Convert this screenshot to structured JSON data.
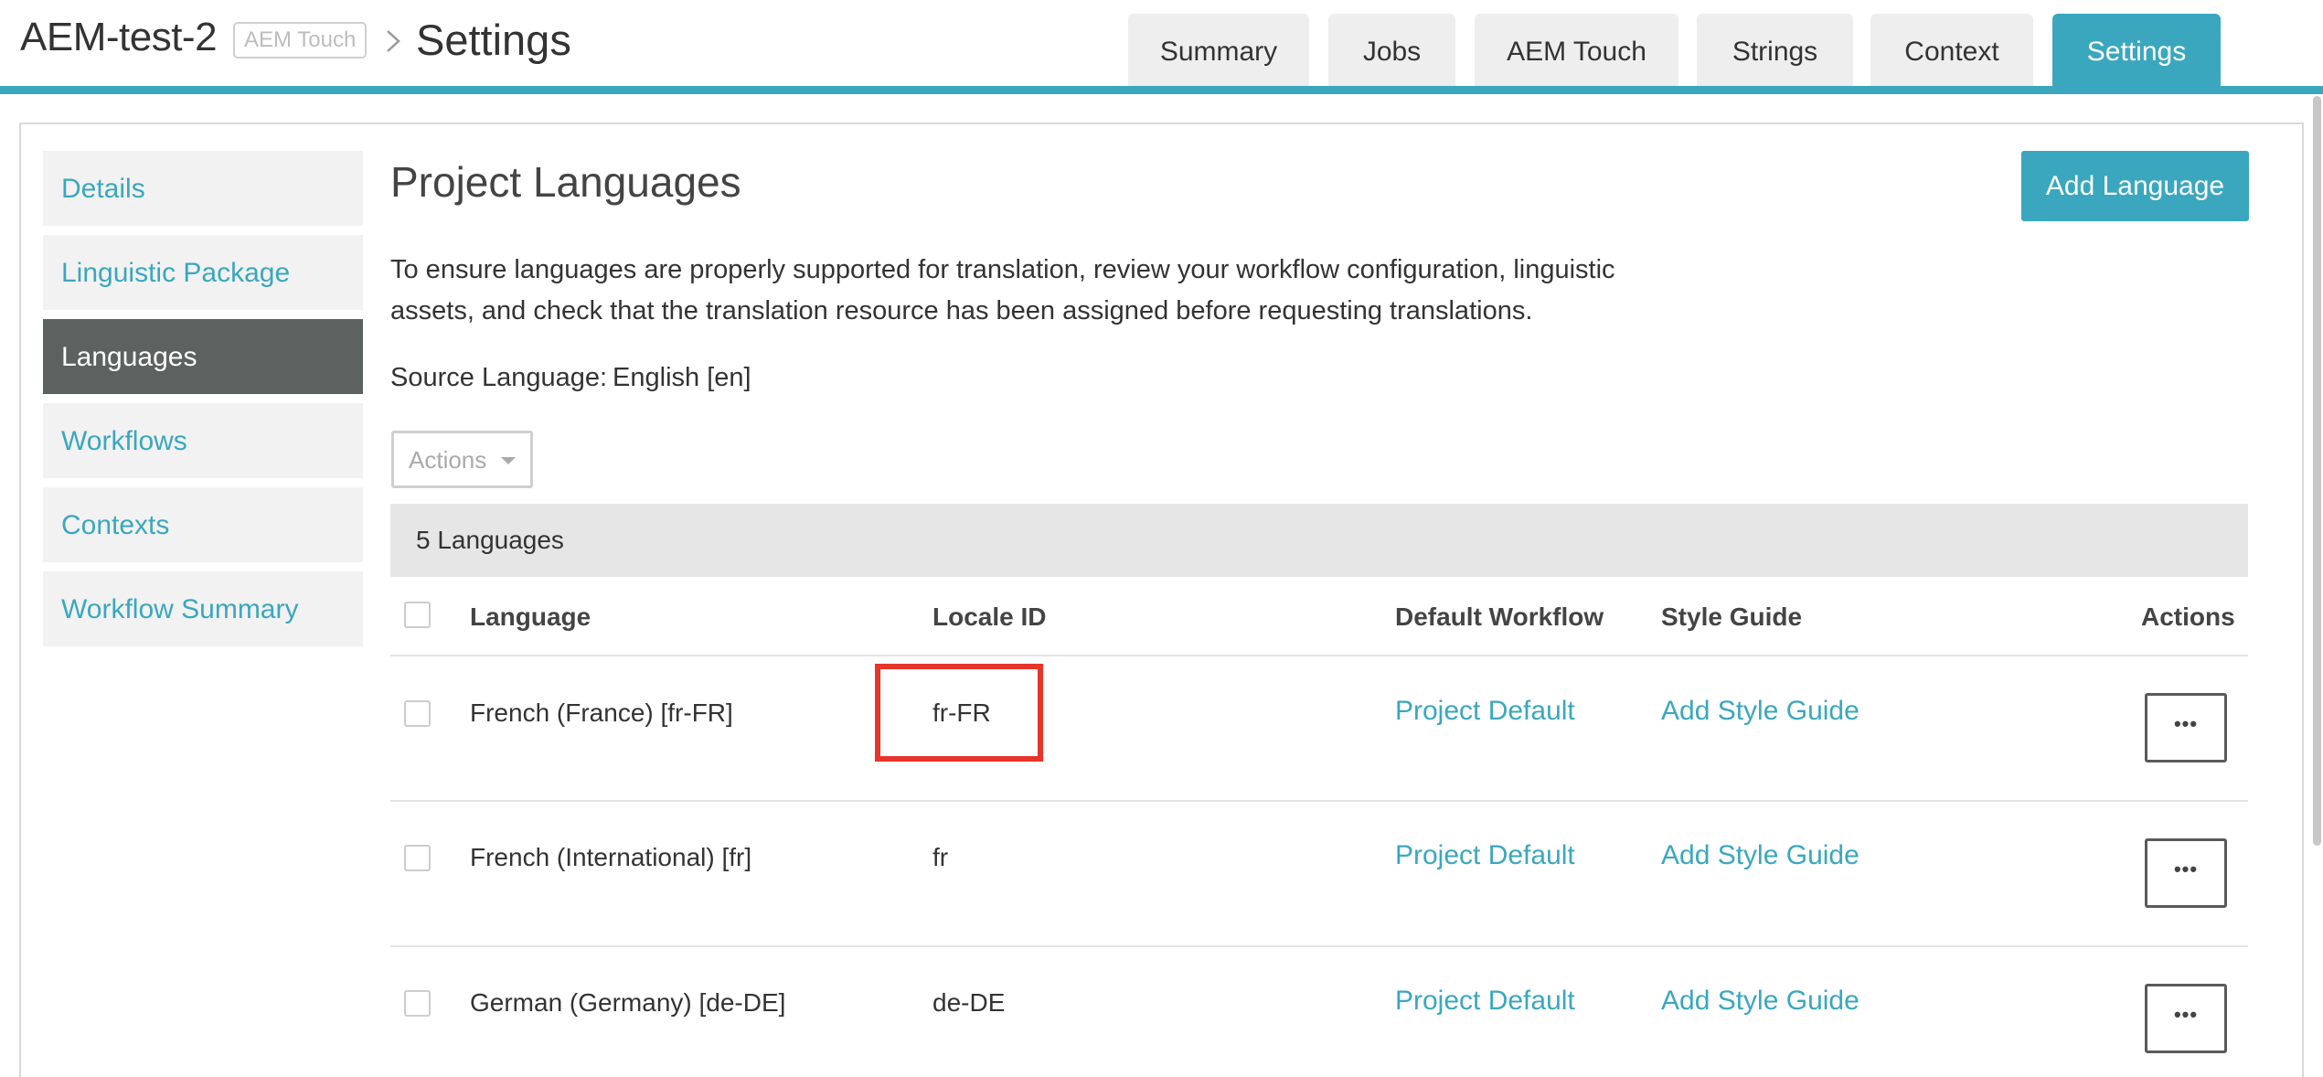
{
  "header": {
    "project_name": "AEM-test-2",
    "project_badge": "AEM Touch",
    "page_title": "Settings",
    "tabs": [
      {
        "label": "Summary",
        "active": false
      },
      {
        "label": "Jobs",
        "active": false
      },
      {
        "label": "AEM Touch",
        "active": false
      },
      {
        "label": "Strings",
        "active": false
      },
      {
        "label": "Context",
        "active": false
      },
      {
        "label": "Settings",
        "active": true
      }
    ]
  },
  "sidebar": {
    "items": [
      {
        "label": "Details",
        "active": false
      },
      {
        "label": "Linguistic Package",
        "active": false
      },
      {
        "label": "Languages",
        "active": true
      },
      {
        "label": "Workflows",
        "active": false
      },
      {
        "label": "Contexts",
        "active": false
      },
      {
        "label": "Workflow Summary",
        "active": false
      }
    ]
  },
  "main": {
    "title": "Project Languages",
    "add_language_label": "Add Language",
    "description_line1": "To ensure languages are properly supported for translation, review your workflow configuration, linguistic",
    "description_line2": "assets, and check that the translation resource has been assigned before requesting translations.",
    "source_language_label": "Source Language:",
    "source_language_value": "English [en]",
    "actions_dropdown_label": "Actions",
    "count_label": "5 Languages",
    "columns": {
      "language": "Language",
      "locale_id": "Locale ID",
      "default_workflow": "Default Workflow",
      "style_guide": "Style Guide",
      "actions": "Actions"
    },
    "rows": [
      {
        "language": "French (France) [fr-FR]",
        "locale_id": "fr-FR",
        "workflow": "Project Default",
        "style_guide": "Add Style Guide",
        "more": "•••"
      },
      {
        "language": "French (International) [fr]",
        "locale_id": "fr",
        "workflow": "Project Default",
        "style_guide": "Add Style Guide",
        "more": "•••"
      },
      {
        "language": "German (Germany) [de-DE]",
        "locale_id": "de-DE",
        "workflow": "Project Default",
        "style_guide": "Add Style Guide",
        "more": "•••"
      }
    ]
  },
  "colors": {
    "accent": "#3aa7bf",
    "sidebar_active_bg": "#5b6260",
    "highlight": "#e6352a"
  }
}
